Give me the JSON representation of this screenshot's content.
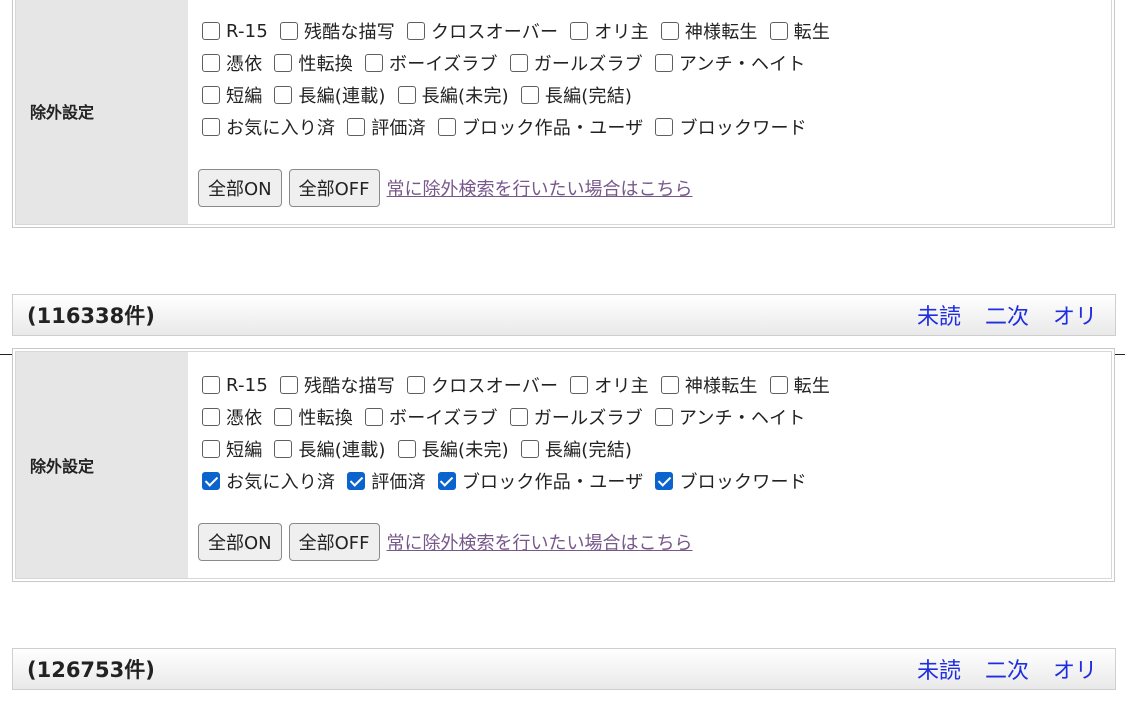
{
  "panels": [
    {
      "label": "除外設定",
      "rows": [
        [
          {
            "label": "R-15",
            "checked": false
          },
          {
            "label": "残酷な描写",
            "checked": false
          },
          {
            "label": "クロスオーバー",
            "checked": false
          },
          {
            "label": "オリ主",
            "checked": false
          },
          {
            "label": "神様転生",
            "checked": false
          },
          {
            "label": "転生",
            "checked": false
          }
        ],
        [
          {
            "label": "憑依",
            "checked": false
          },
          {
            "label": "性転換",
            "checked": false
          },
          {
            "label": "ボーイズラブ",
            "checked": false
          },
          {
            "label": "ガールズラブ",
            "checked": false
          },
          {
            "label": "アンチ・ヘイト",
            "checked": false
          }
        ],
        [
          {
            "label": "短編",
            "checked": false
          },
          {
            "label": "長編(連載)",
            "checked": false
          },
          {
            "label": "長編(未完)",
            "checked": false
          },
          {
            "label": "長編(完結)",
            "checked": false
          }
        ],
        [
          {
            "label": "お気に入り済",
            "checked": false
          },
          {
            "label": "評価済",
            "checked": false
          },
          {
            "label": "ブロック作品・ユーザ",
            "checked": false
          },
          {
            "label": "ブロックワード",
            "checked": false
          }
        ]
      ],
      "all_on_label": "全部ON",
      "all_off_label": "全部OFF",
      "always_link": "常に除外検索を行いたい場合はこちら"
    },
    {
      "label": "除外設定",
      "rows": [
        [
          {
            "label": "R-15",
            "checked": false
          },
          {
            "label": "残酷な描写",
            "checked": false
          },
          {
            "label": "クロスオーバー",
            "checked": false
          },
          {
            "label": "オリ主",
            "checked": false
          },
          {
            "label": "神様転生",
            "checked": false
          },
          {
            "label": "転生",
            "checked": false
          }
        ],
        [
          {
            "label": "憑依",
            "checked": false
          },
          {
            "label": "性転換",
            "checked": false
          },
          {
            "label": "ボーイズラブ",
            "checked": false
          },
          {
            "label": "ガールズラブ",
            "checked": false
          },
          {
            "label": "アンチ・ヘイト",
            "checked": false
          }
        ],
        [
          {
            "label": "短編",
            "checked": false
          },
          {
            "label": "長編(連載)",
            "checked": false
          },
          {
            "label": "長編(未完)",
            "checked": false
          },
          {
            "label": "長編(完結)",
            "checked": false
          }
        ],
        [
          {
            "label": "お気に入り済",
            "checked": true
          },
          {
            "label": "評価済",
            "checked": true
          },
          {
            "label": "ブロック作品・ユーザ",
            "checked": true
          },
          {
            "label": "ブロックワード",
            "checked": true
          }
        ]
      ],
      "all_on_label": "全部ON",
      "all_off_label": "全部OFF",
      "always_link": "常に除外検索を行いたい場合はこちら"
    }
  ],
  "results": [
    {
      "count": "(116338件)",
      "links": [
        "未読",
        "二次",
        "オリ"
      ]
    },
    {
      "count": "(126753件)",
      "links": [
        "未読",
        "二次",
        "オリ"
      ]
    }
  ],
  "colors": {
    "checkbox_checked": "#0b63ce",
    "link_blue": "#1f2ee0",
    "visited_link": "#77588a",
    "label_bg": "#e6e6e6"
  }
}
